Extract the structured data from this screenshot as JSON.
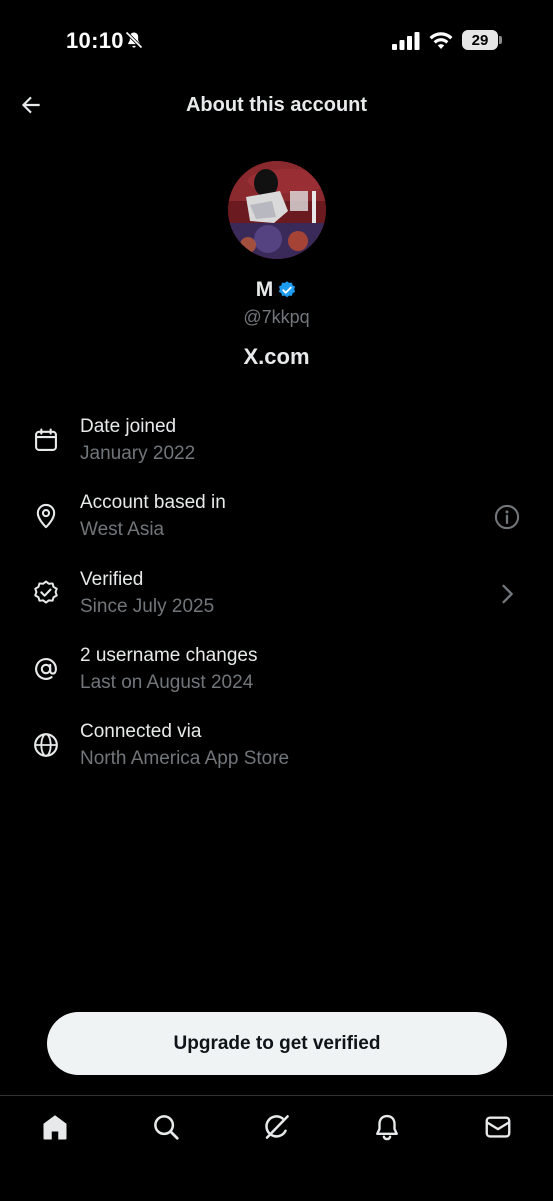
{
  "status_bar": {
    "time": "10:10",
    "battery": "29",
    "icons": [
      "bell-slash-icon",
      "signal-icon",
      "wifi-icon",
      "battery-icon"
    ]
  },
  "header": {
    "title": "About this account",
    "back_icon": "arrow-left-icon"
  },
  "profile": {
    "display_name": "M",
    "handle": "@7kkpq",
    "site": "X.com",
    "verified_color": "#1d9bf0"
  },
  "info_items": [
    {
      "icon": "calendar-icon",
      "label": "Date joined",
      "value": "January 2022"
    },
    {
      "icon": "location-pin-icon",
      "label": "Account based in",
      "value": "West Asia",
      "trailing": "info-icon"
    },
    {
      "icon": "verified-badge-icon",
      "label": "Verified",
      "value": "Since July 2025",
      "trailing": "chevron-right-icon"
    },
    {
      "icon": "at-sign-icon",
      "label": "2 username changes",
      "value": "Last on August 2024"
    },
    {
      "icon": "globe-icon",
      "label": "Connected via",
      "value": "North America App Store"
    }
  ],
  "upgrade_button": {
    "label": "Upgrade to get verified"
  },
  "bottom_nav": [
    "home-icon",
    "search-icon",
    "grok-icon",
    "notifications-icon",
    "messages-icon"
  ],
  "colors": {
    "background": "#000000",
    "primary_text": "#e7e9ea",
    "secondary_text": "#71767b",
    "button_bg": "#eff3f4"
  }
}
